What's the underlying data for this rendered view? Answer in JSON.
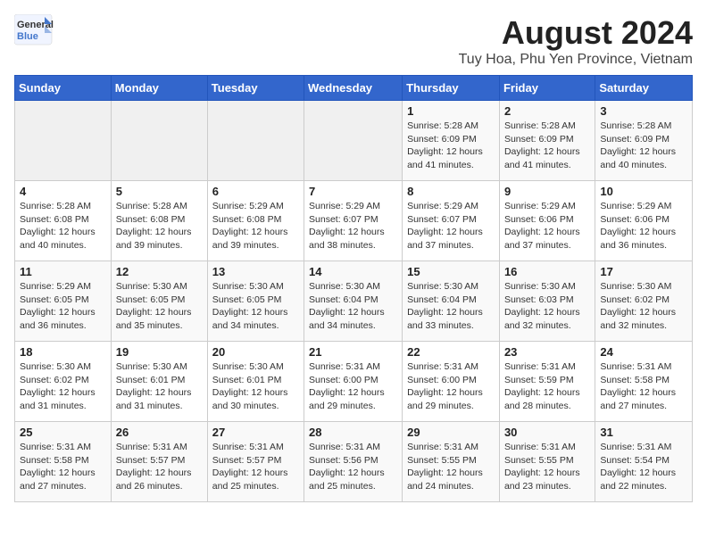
{
  "logo": {
    "general": "General",
    "blue": "Blue"
  },
  "title": "August 2024",
  "subtitle": "Tuy Hoa, Phu Yen Province, Vietnam",
  "weekdays": [
    "Sunday",
    "Monday",
    "Tuesday",
    "Wednesday",
    "Thursday",
    "Friday",
    "Saturday"
  ],
  "weeks": [
    [
      {
        "day": "",
        "detail": ""
      },
      {
        "day": "",
        "detail": ""
      },
      {
        "day": "",
        "detail": ""
      },
      {
        "day": "",
        "detail": ""
      },
      {
        "day": "1",
        "detail": "Sunrise: 5:28 AM\nSunset: 6:09 PM\nDaylight: 12 hours\nand 41 minutes."
      },
      {
        "day": "2",
        "detail": "Sunrise: 5:28 AM\nSunset: 6:09 PM\nDaylight: 12 hours\nand 41 minutes."
      },
      {
        "day": "3",
        "detail": "Sunrise: 5:28 AM\nSunset: 6:09 PM\nDaylight: 12 hours\nand 40 minutes."
      }
    ],
    [
      {
        "day": "4",
        "detail": "Sunrise: 5:28 AM\nSunset: 6:08 PM\nDaylight: 12 hours\nand 40 minutes."
      },
      {
        "day": "5",
        "detail": "Sunrise: 5:28 AM\nSunset: 6:08 PM\nDaylight: 12 hours\nand 39 minutes."
      },
      {
        "day": "6",
        "detail": "Sunrise: 5:29 AM\nSunset: 6:08 PM\nDaylight: 12 hours\nand 39 minutes."
      },
      {
        "day": "7",
        "detail": "Sunrise: 5:29 AM\nSunset: 6:07 PM\nDaylight: 12 hours\nand 38 minutes."
      },
      {
        "day": "8",
        "detail": "Sunrise: 5:29 AM\nSunset: 6:07 PM\nDaylight: 12 hours\nand 37 minutes."
      },
      {
        "day": "9",
        "detail": "Sunrise: 5:29 AM\nSunset: 6:06 PM\nDaylight: 12 hours\nand 37 minutes."
      },
      {
        "day": "10",
        "detail": "Sunrise: 5:29 AM\nSunset: 6:06 PM\nDaylight: 12 hours\nand 36 minutes."
      }
    ],
    [
      {
        "day": "11",
        "detail": "Sunrise: 5:29 AM\nSunset: 6:05 PM\nDaylight: 12 hours\nand 36 minutes."
      },
      {
        "day": "12",
        "detail": "Sunrise: 5:30 AM\nSunset: 6:05 PM\nDaylight: 12 hours\nand 35 minutes."
      },
      {
        "day": "13",
        "detail": "Sunrise: 5:30 AM\nSunset: 6:05 PM\nDaylight: 12 hours\nand 34 minutes."
      },
      {
        "day": "14",
        "detail": "Sunrise: 5:30 AM\nSunset: 6:04 PM\nDaylight: 12 hours\nand 34 minutes."
      },
      {
        "day": "15",
        "detail": "Sunrise: 5:30 AM\nSunset: 6:04 PM\nDaylight: 12 hours\nand 33 minutes."
      },
      {
        "day": "16",
        "detail": "Sunrise: 5:30 AM\nSunset: 6:03 PM\nDaylight: 12 hours\nand 32 minutes."
      },
      {
        "day": "17",
        "detail": "Sunrise: 5:30 AM\nSunset: 6:02 PM\nDaylight: 12 hours\nand 32 minutes."
      }
    ],
    [
      {
        "day": "18",
        "detail": "Sunrise: 5:30 AM\nSunset: 6:02 PM\nDaylight: 12 hours\nand 31 minutes."
      },
      {
        "day": "19",
        "detail": "Sunrise: 5:30 AM\nSunset: 6:01 PM\nDaylight: 12 hours\nand 31 minutes."
      },
      {
        "day": "20",
        "detail": "Sunrise: 5:30 AM\nSunset: 6:01 PM\nDaylight: 12 hours\nand 30 minutes."
      },
      {
        "day": "21",
        "detail": "Sunrise: 5:31 AM\nSunset: 6:00 PM\nDaylight: 12 hours\nand 29 minutes."
      },
      {
        "day": "22",
        "detail": "Sunrise: 5:31 AM\nSunset: 6:00 PM\nDaylight: 12 hours\nand 29 minutes."
      },
      {
        "day": "23",
        "detail": "Sunrise: 5:31 AM\nSunset: 5:59 PM\nDaylight: 12 hours\nand 28 minutes."
      },
      {
        "day": "24",
        "detail": "Sunrise: 5:31 AM\nSunset: 5:58 PM\nDaylight: 12 hours\nand 27 minutes."
      }
    ],
    [
      {
        "day": "25",
        "detail": "Sunrise: 5:31 AM\nSunset: 5:58 PM\nDaylight: 12 hours\nand 27 minutes."
      },
      {
        "day": "26",
        "detail": "Sunrise: 5:31 AM\nSunset: 5:57 PM\nDaylight: 12 hours\nand 26 minutes."
      },
      {
        "day": "27",
        "detail": "Sunrise: 5:31 AM\nSunset: 5:57 PM\nDaylight: 12 hours\nand 25 minutes."
      },
      {
        "day": "28",
        "detail": "Sunrise: 5:31 AM\nSunset: 5:56 PM\nDaylight: 12 hours\nand 25 minutes."
      },
      {
        "day": "29",
        "detail": "Sunrise: 5:31 AM\nSunset: 5:55 PM\nDaylight: 12 hours\nand 24 minutes."
      },
      {
        "day": "30",
        "detail": "Sunrise: 5:31 AM\nSunset: 5:55 PM\nDaylight: 12 hours\nand 23 minutes."
      },
      {
        "day": "31",
        "detail": "Sunrise: 5:31 AM\nSunset: 5:54 PM\nDaylight: 12 hours\nand 22 minutes."
      }
    ]
  ]
}
